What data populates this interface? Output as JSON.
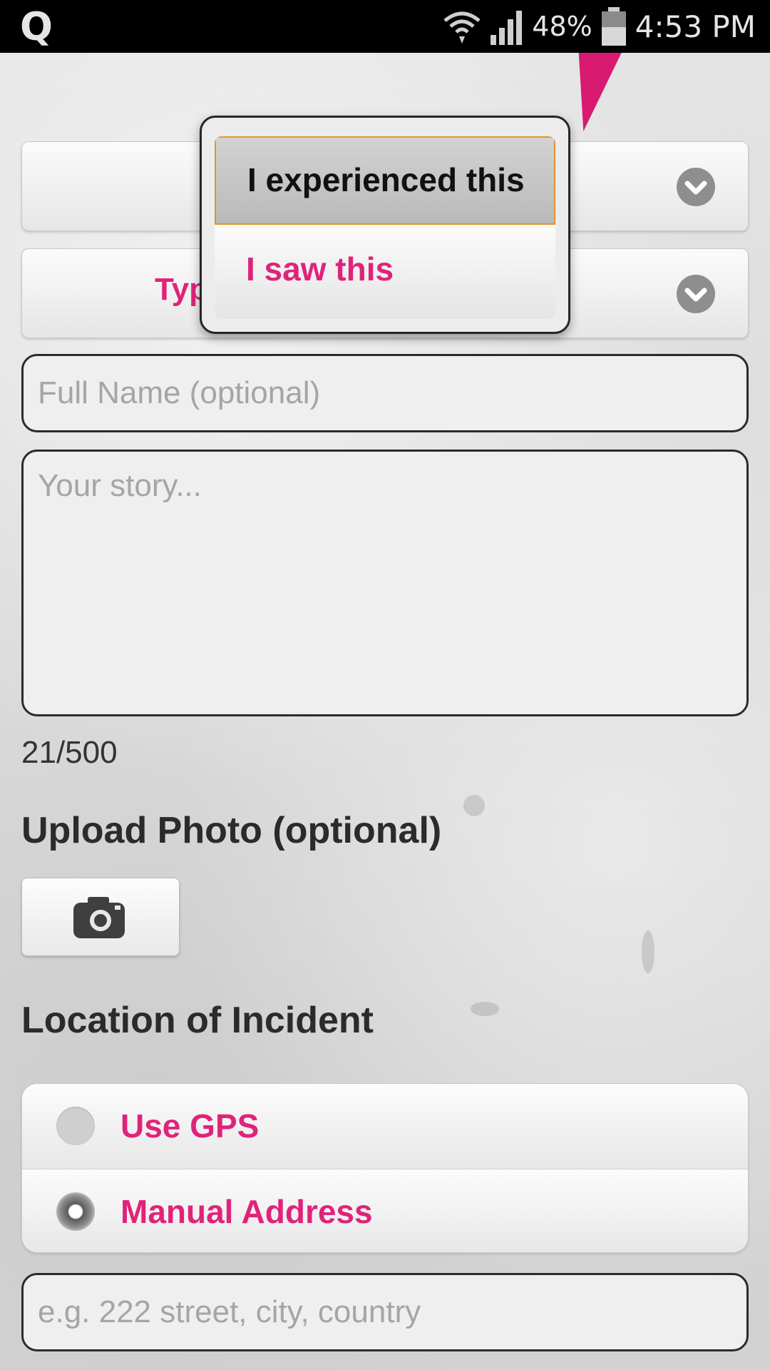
{
  "status_bar": {
    "app_letter": "Q",
    "battery_percent": "48%",
    "time": "4:53 PM"
  },
  "form": {
    "select_1_label": "",
    "select_2_label": "Typ",
    "name_placeholder": "Full Name (optional)",
    "story_placeholder": "Your story...",
    "char_counter": "21/500",
    "upload_heading": "Upload Photo (optional)",
    "location_heading": "Location of Incident",
    "location_options": [
      {
        "label": "Use GPS",
        "selected": false
      },
      {
        "label": "Manual Address",
        "selected": true
      }
    ],
    "address_placeholder": "e.g. 222 street, city, country"
  },
  "dropdown": {
    "options": [
      {
        "label": "I experienced this",
        "selected": true
      },
      {
        "label": "I saw this",
        "selected": false
      }
    ]
  },
  "colors": {
    "accent_pink": "#e0237a",
    "selected_border": "#e0952a"
  },
  "icons": [
    "wifi-icon",
    "signal-icon",
    "battery-icon",
    "chevron-down-icon",
    "camera-icon"
  ]
}
